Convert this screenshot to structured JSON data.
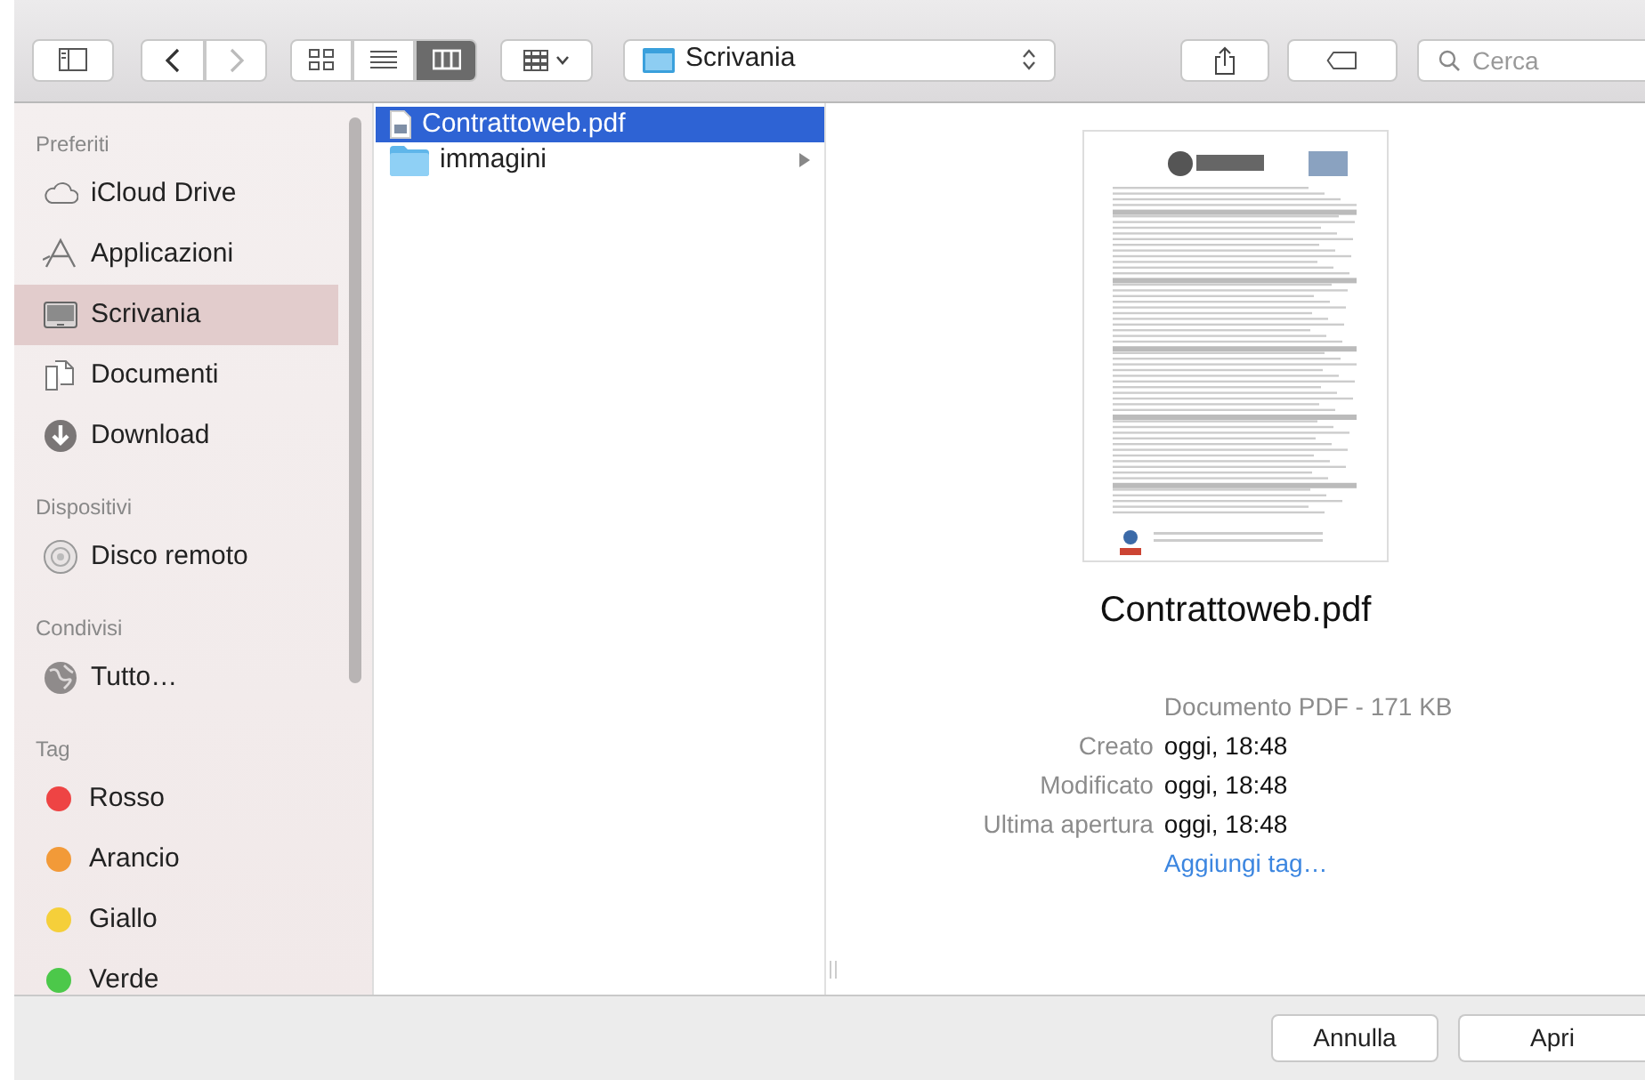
{
  "toolbar": {
    "view_modes": [
      {
        "kind": "icons",
        "selected": false
      },
      {
        "kind": "list",
        "selected": false
      },
      {
        "kind": "columns",
        "selected": true
      }
    ],
    "location": "Scrivania",
    "search": {
      "placeholder": "Cerca"
    }
  },
  "sidebar": {
    "sections": [
      {
        "title": "Preferiti",
        "items": [
          {
            "label": "iCloud Drive",
            "kind": "cloud",
            "selected": false
          },
          {
            "label": "Applicazioni",
            "kind": "apps",
            "selected": false
          },
          {
            "label": "Scrivania",
            "kind": "desktop",
            "selected": true
          },
          {
            "label": "Documenti",
            "kind": "documents",
            "selected": false
          },
          {
            "label": "Download",
            "kind": "download",
            "selected": false
          }
        ]
      },
      {
        "title": "Dispositivi",
        "items": [
          {
            "label": "Disco remoto",
            "kind": "disk",
            "selected": false
          }
        ]
      },
      {
        "title": "Condivisi",
        "items": [
          {
            "label": "Tutto…",
            "kind": "network",
            "selected": false
          }
        ]
      },
      {
        "title": "Tag",
        "items": [
          {
            "label": "Rosso",
            "kind": "tag",
            "color": "#ee4444",
            "selected": false
          },
          {
            "label": "Arancio",
            "kind": "tag",
            "color": "#f29a38",
            "selected": false
          },
          {
            "label": "Giallo",
            "kind": "tag",
            "color": "#f5cf3a",
            "selected": false
          },
          {
            "label": "Verde",
            "kind": "tag",
            "color": "#4cc84a",
            "selected": false
          }
        ]
      }
    ]
  },
  "column": {
    "items": [
      {
        "name": "Contrattoweb.pdf",
        "kind": "pdf",
        "selected": true
      },
      {
        "name": "immagini",
        "kind": "folder",
        "selected": false
      }
    ]
  },
  "preview": {
    "name": "Contrattoweb.pdf",
    "summary": "Documento PDF - 171 KB",
    "details": [
      {
        "label": "Creato",
        "value": "oggi, 18:48"
      },
      {
        "label": "Modificato",
        "value": "oggi, 18:48"
      },
      {
        "label": "Ultima apertura",
        "value": "oggi, 18:48"
      }
    ],
    "add_tag": "Aggiungi tag…"
  },
  "buttons": [
    "Annulla",
    "Apri"
  ]
}
